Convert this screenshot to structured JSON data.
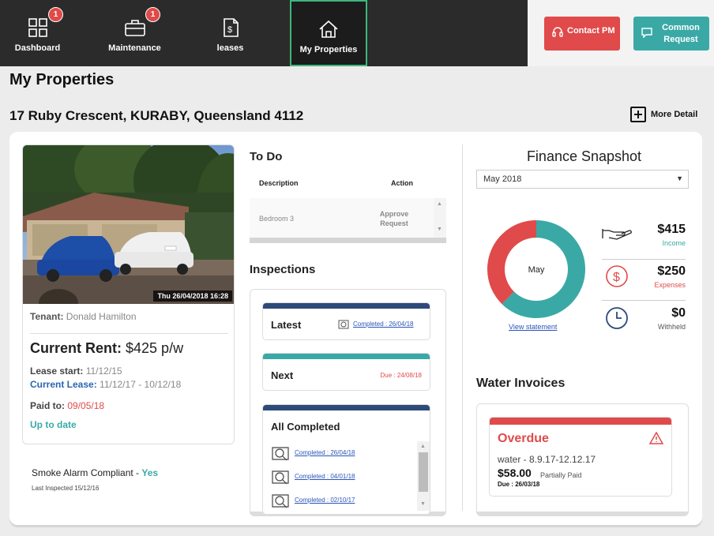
{
  "nav": {
    "items": [
      {
        "label": "Dashboard",
        "badge": "1",
        "icon": "dashboard-icon"
      },
      {
        "label": "Maintenance",
        "badge": "1",
        "icon": "toolbox-icon"
      },
      {
        "label": "leases",
        "icon": "document-dollar-icon"
      },
      {
        "label": "My Properties",
        "icon": "house-icon",
        "active": true
      }
    ],
    "contact_pm": "Contact PM",
    "common_request": "Common Request"
  },
  "page_title": "My Properties",
  "address": "17 Ruby Crescent, KURABY, Queensland 4112",
  "more_detail": "More Detail",
  "property": {
    "photo_timestamp": "Thu 26/04/2018 16:28",
    "tenant_label": "Tenant:",
    "tenant_name": "Donald Hamilton",
    "rent_label": "Current Rent:",
    "rent_value": "$425 p/w",
    "lease_start_label": "Lease start:",
    "lease_start_value": "11/12/15",
    "current_lease_label": "Current Lease:",
    "current_lease_value": "11/12/17 - 10/12/18",
    "paid_to_label": "Paid to:",
    "paid_to_value": "09/05/18",
    "status": "Up to date",
    "smoke_label": "Smoke Alarm Compliant -",
    "smoke_value": "Yes",
    "last_inspected": "Last Inspected 15/12/16"
  },
  "todo": {
    "title": "To Do",
    "col_description": "Description",
    "col_action": "Action",
    "rows": [
      {
        "description": "Bedroom 3",
        "action": "Approve Request"
      }
    ]
  },
  "inspections": {
    "title": "Inspections",
    "latest_title": "Latest",
    "latest_link": "Completed : 26/04/18",
    "next_title": "Next",
    "next_due": "Due : 24/08/18",
    "all_title": "All Completed",
    "completed": [
      "Completed : 26/04/18",
      "Completed : 04/01/18",
      "Completed : 02/10/17"
    ]
  },
  "finance": {
    "title": "Finance Snapshot",
    "month_select": "May 2018",
    "donut_label": "May",
    "view_statement": "View statement",
    "income": {
      "amount": "$415",
      "label": "Income",
      "color": "#3aa9a6"
    },
    "expenses": {
      "amount": "$250",
      "label": "Expenses",
      "color": "#e04a4a"
    },
    "withheld": {
      "amount": "$0",
      "label": "Withheld",
      "color": "#2d4a7a"
    }
  },
  "water": {
    "title": "Water Invoices",
    "status": "Overdue",
    "description": "water - 8.9.17-12.12.17",
    "amount": "$58.00",
    "amount_note": "Partially Paid",
    "due": "Due : 26/03/18"
  },
  "colors": {
    "teal": "#3aa9a6",
    "red": "#e04a4a",
    "navy": "#2d4a7a",
    "nav_bg": "#2b2b2b",
    "active_border": "#3fb67a"
  }
}
